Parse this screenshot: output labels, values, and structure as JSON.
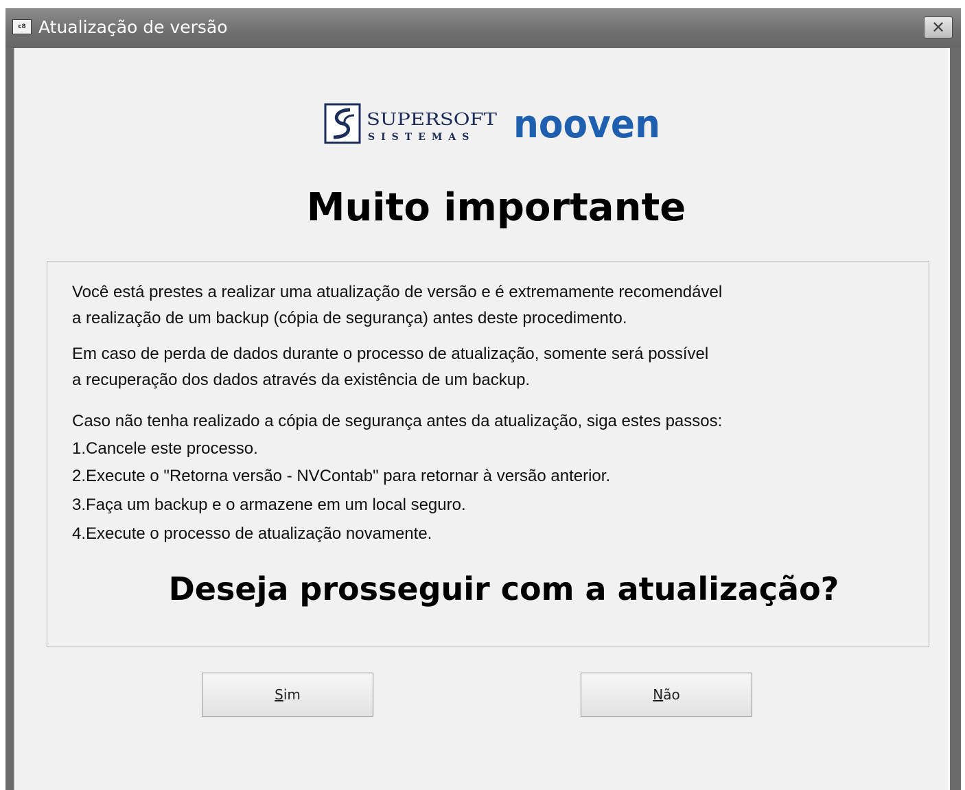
{
  "window": {
    "title": "Atualização de versão",
    "app_icon_text": "c8",
    "close_glyph": "✕"
  },
  "logo": {
    "supersoft": "SUPERSOFT",
    "sistemas": "SISTEMAS",
    "nooven": "nooven",
    "brand_color": "#1f5fb0"
  },
  "heading": "Muito importante",
  "panel": {
    "lines": [
      "Você está prestes a realizar uma atualização de versão e é extremamente recomendável",
      "a realização  de  um  backup (cópia  de  segurança)  antes deste procedimento.",
      "Em caso de perda de dados durante o processo de atualização, somente  será possível",
      "a  recuperação  dos  dados  através  da  existência  de um backup.",
      "Caso não tenha realizado a cópia de segurança antes da atualização, siga estes passos:",
      "1.Cancele  este  processo.",
      "2.Execute o \"Retorna versão - NVContab\" para retornar à versão anterior.",
      "3.Faça um backup e o armazene em um local seguro.",
      "4.Execute o processo de atualização novamente."
    ],
    "question": "Deseja prosseguir com a atualização?"
  },
  "buttons": {
    "yes": {
      "mnemonic": "S",
      "rest": "im"
    },
    "no": {
      "mnemonic": "N",
      "rest": "ão"
    }
  }
}
